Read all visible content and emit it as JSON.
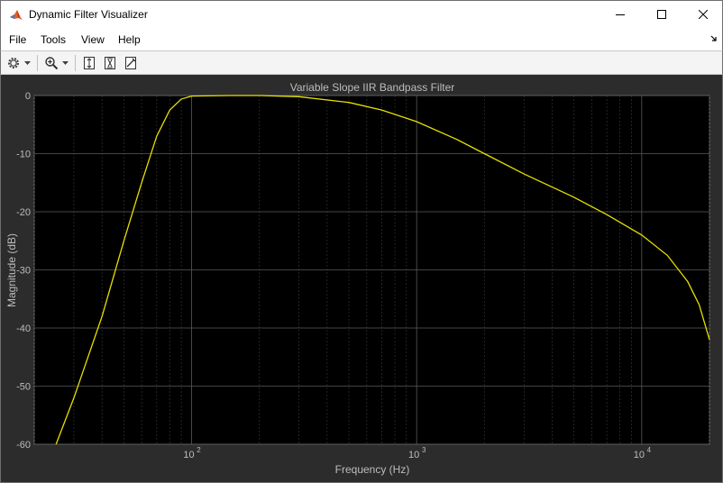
{
  "window": {
    "title": "Dynamic Filter Visualizer",
    "controls": [
      "minimize",
      "maximize",
      "close"
    ]
  },
  "menu": {
    "items": [
      "File",
      "Tools",
      "View",
      "Help"
    ]
  },
  "toolbar": {
    "buttons": [
      "gear-icon",
      "dropdown-arrow-icon",
      "zoom-in-icon",
      "dropdown-arrow-icon",
      "autoscale-icon",
      "zoom-x-icon",
      "data-cursor-icon"
    ]
  },
  "colors": {
    "figure_bg": "#2c2c2c",
    "axes_bg": "#000000",
    "grid": "#404040",
    "text": "#bdbdbd",
    "curve": "#e8e000"
  },
  "chart_data": {
    "type": "line",
    "title": "Variable Slope IIR Bandpass Filter",
    "xlabel": "Frequency (Hz)",
    "ylabel": "Magnitude (dB)",
    "x_scale": "log",
    "xlim": [
      20,
      20000
    ],
    "ylim": [
      -60,
      0
    ],
    "x_ticks": [
      100,
      1000,
      10000
    ],
    "x_tick_labels": [
      {
        "base": "10",
        "exp": "2"
      },
      {
        "base": "10",
        "exp": "3"
      },
      {
        "base": "10",
        "exp": "4"
      }
    ],
    "y_ticks": [
      0,
      -10,
      -20,
      -30,
      -40,
      -50,
      -60
    ],
    "y_tick_labels": [
      "0",
      "-10",
      "-20",
      "-30",
      "-40",
      "-50",
      "-60"
    ],
    "grid": true,
    "series": [
      {
        "points": [
          [
            25,
            -60
          ],
          [
            30,
            -52
          ],
          [
            40,
            -38
          ],
          [
            50,
            -25
          ],
          [
            60,
            -15
          ],
          [
            70,
            -7
          ],
          [
            80,
            -2.5
          ],
          [
            90,
            -0.6
          ],
          [
            100,
            -0.1
          ],
          [
            150,
            0
          ],
          [
            200,
            0
          ],
          [
            300,
            -0.2
          ],
          [
            500,
            -1.2
          ],
          [
            700,
            -2.5
          ],
          [
            1000,
            -4.5
          ],
          [
            1500,
            -7.5
          ],
          [
            2000,
            -10
          ],
          [
            3000,
            -13.5
          ],
          [
            5000,
            -17.5
          ],
          [
            7000,
            -20.5
          ],
          [
            10000,
            -24
          ],
          [
            13000,
            -27.5
          ],
          [
            16000,
            -32
          ],
          [
            18000,
            -36
          ],
          [
            20000,
            -42
          ]
        ]
      }
    ]
  }
}
